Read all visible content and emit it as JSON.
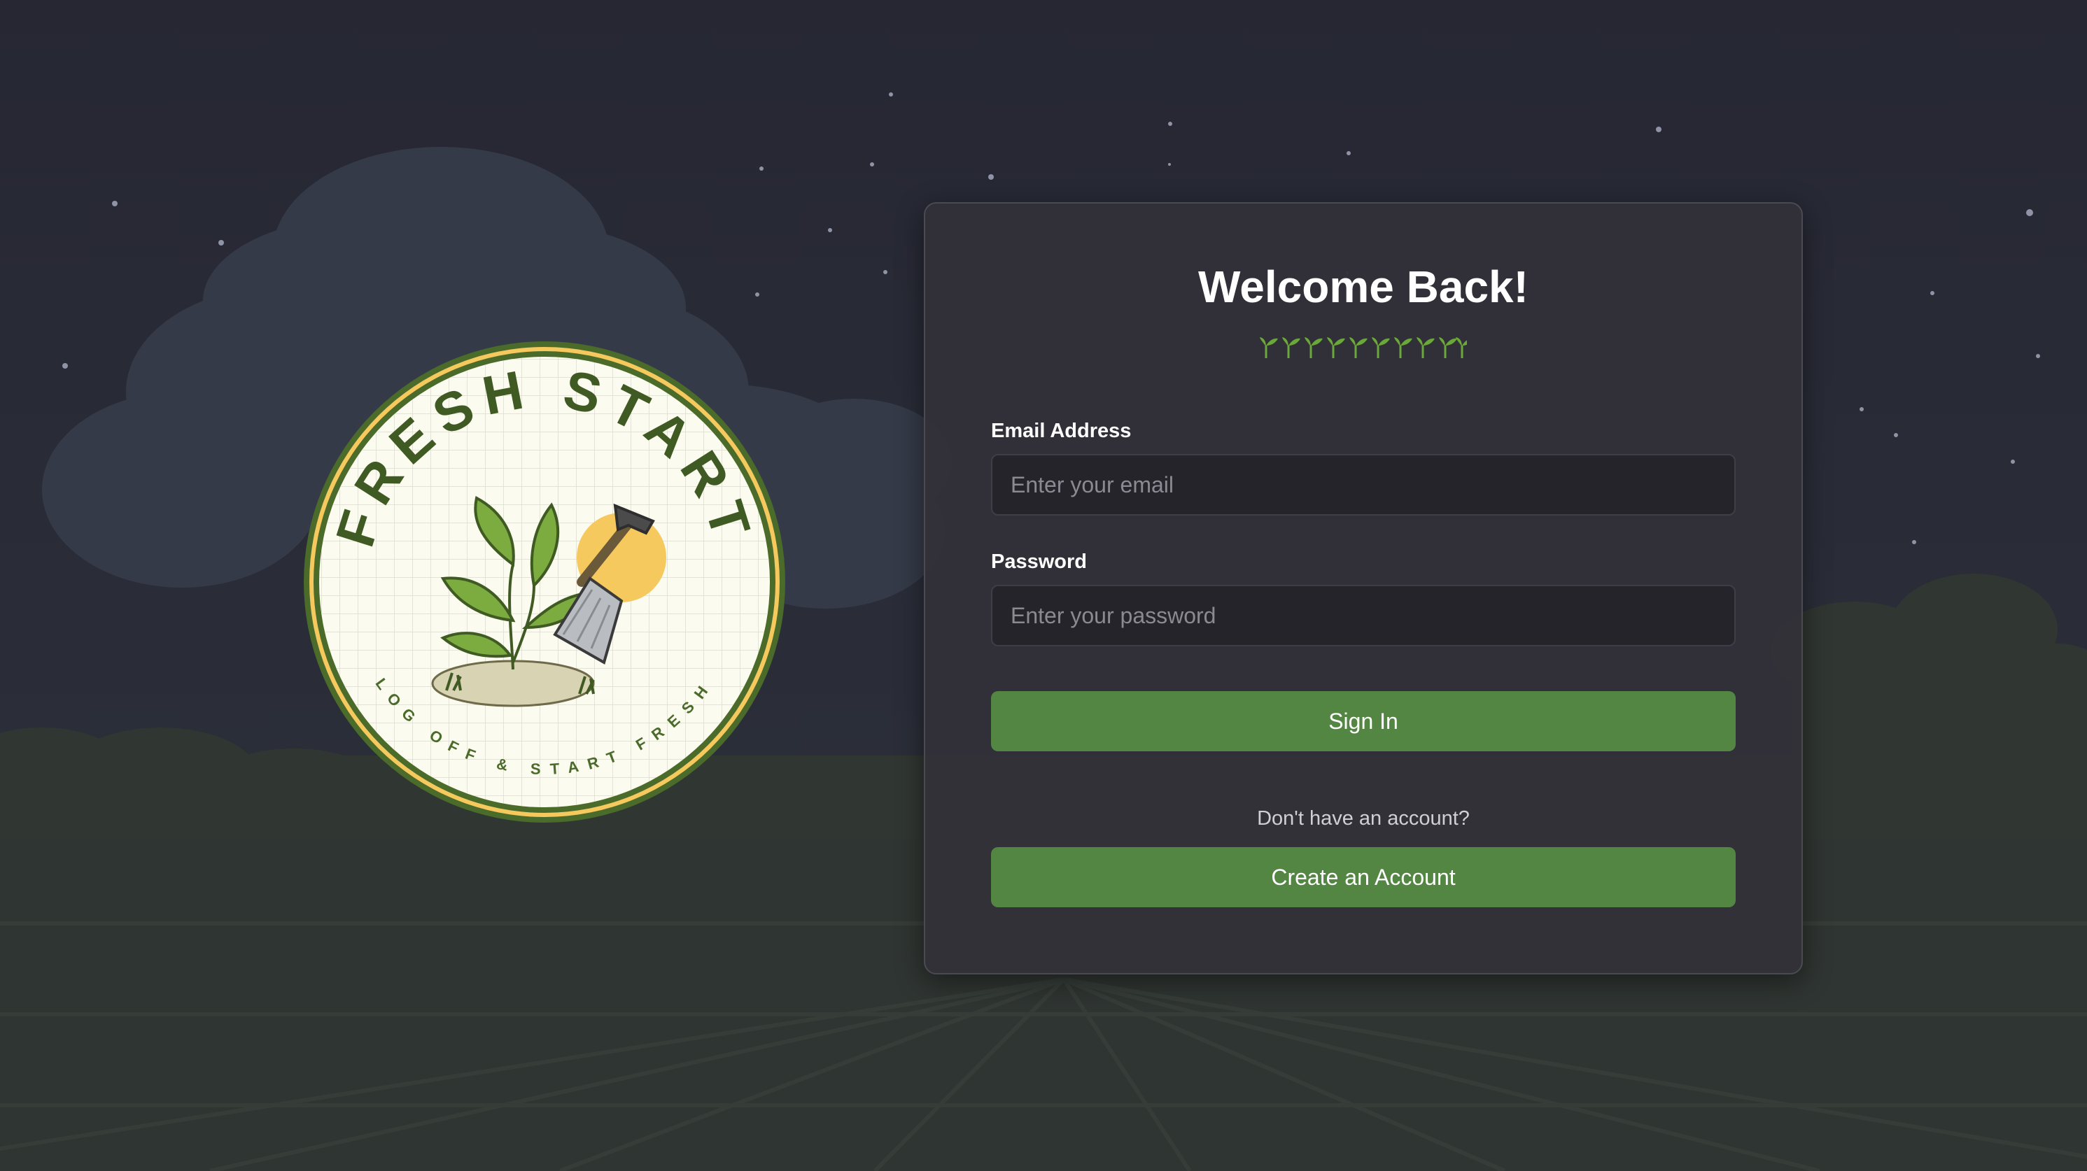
{
  "logo": {
    "title": "FRESH START",
    "tagline": "LOG OFF & START FRESH"
  },
  "login": {
    "title": "Welcome Back!",
    "email_label": "Email Address",
    "email_placeholder": "Enter your email",
    "email_value": "",
    "password_label": "Password",
    "password_placeholder": "Enter your password",
    "password_value": "",
    "sign_in_label": "Sign In",
    "no_account_text": "Don't have an account?",
    "create_account_label": "Create an Account",
    "decoration_icon": "sprout-icon"
  },
  "colors": {
    "background": "#262733",
    "card": "#323138",
    "button": "#538543",
    "logo_green": "#4b6b2a",
    "logo_sun": "#f5c95d",
    "logo_cream": "#fbfbef"
  }
}
